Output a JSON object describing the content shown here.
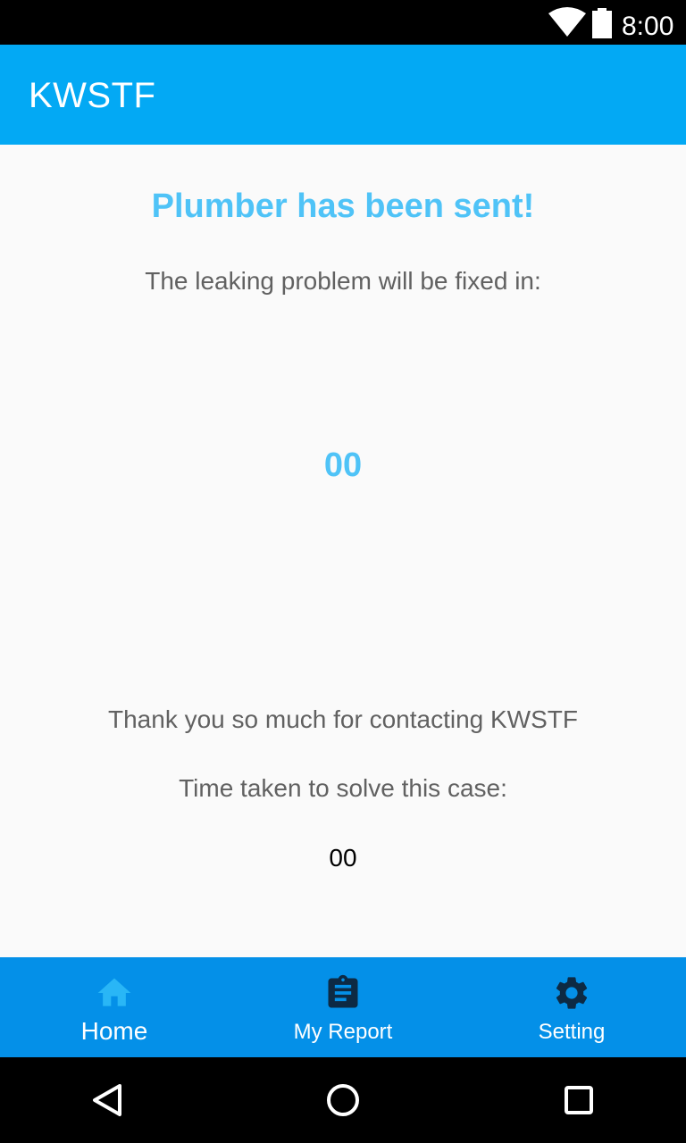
{
  "status_bar": {
    "time": "8:00",
    "icons": [
      "wifi-icon",
      "battery-icon"
    ]
  },
  "app_bar": {
    "title": "KWSTF"
  },
  "main": {
    "headline": "Plumber has been sent!",
    "subline": "The leaking problem will be fixed in:",
    "countdown": "00",
    "thanks": "Thank you so much for contacting KWSTF",
    "time_label": "Time taken to solve this case:",
    "time_value": "00"
  },
  "bottom_nav": {
    "items": [
      {
        "label": "Home",
        "icon": "home-icon",
        "active": true
      },
      {
        "label": "My Report",
        "icon": "clipboard-icon",
        "active": false
      },
      {
        "label": "Setting",
        "icon": "gear-icon",
        "active": false
      }
    ]
  },
  "system_nav": {
    "icons": [
      "back-icon",
      "home-circle-icon",
      "recents-icon"
    ]
  },
  "colors": {
    "app_bar": "#03a9f4",
    "accent_text": "#4fc3f7",
    "bottom_nav": "#0490e8",
    "active_icon": "#29b6f6",
    "inactive_icon": "#0d2a44"
  }
}
